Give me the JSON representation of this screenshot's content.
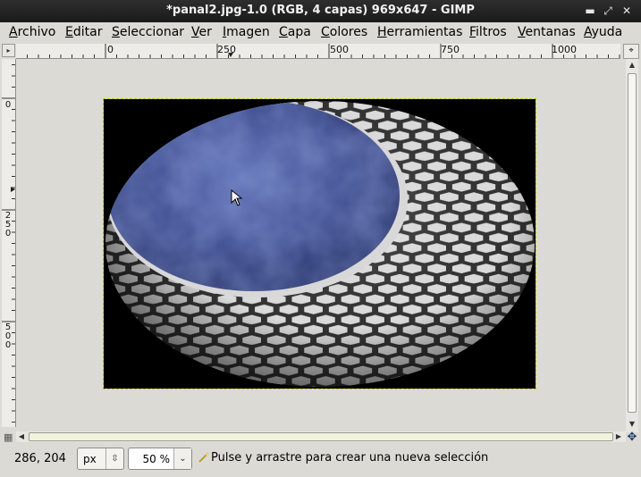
{
  "window": {
    "title": "*panal2.jpg-1.0 (RGB, 4 capas) 969x647 - GIMP",
    "controls": [
      "minimize-icon",
      "maximize-icon",
      "close-icon"
    ]
  },
  "menubar": {
    "items": [
      {
        "label": "Archivo",
        "mnemonic_index": 0
      },
      {
        "label": "Editar",
        "mnemonic_index": 0
      },
      {
        "label": "Seleccionar",
        "mnemonic_index": 0
      },
      {
        "label": "Ver",
        "mnemonic_index": 0
      },
      {
        "label": "Imagen",
        "mnemonic_index": 0
      },
      {
        "label": "Capa",
        "mnemonic_index": 0
      },
      {
        "label": "Colores",
        "mnemonic_index": 0
      },
      {
        "label": "Herramientas",
        "mnemonic_index": 0
      },
      {
        "label": "Filtros",
        "mnemonic_index": 0
      },
      {
        "label": "Ventanas",
        "mnemonic_index": 0
      },
      {
        "label": "Ayuda",
        "mnemonic_index": 0
      }
    ]
  },
  "rulers": {
    "horizontal_labels": [
      "0",
      "250",
      "500",
      "750",
      "1000"
    ],
    "vertical_labels": [
      "0",
      "250",
      "500"
    ]
  },
  "canvas": {
    "image_name": "panal2.jpg",
    "background": "#000000",
    "selection_color": "#c7c700"
  },
  "statusbar": {
    "pointer_coords": "286, 204",
    "unit": "px",
    "zoom": "50 %",
    "hint": "Pulse y arrastre para crear una nueva selección",
    "hint_icon": "rect-select-icon"
  },
  "colors": {
    "titlebar": "#1f1f1f",
    "chrome": "#dcdad5",
    "scroll_thumb": "#f0f5da",
    "sphere_blue": "#3b4a8c"
  }
}
